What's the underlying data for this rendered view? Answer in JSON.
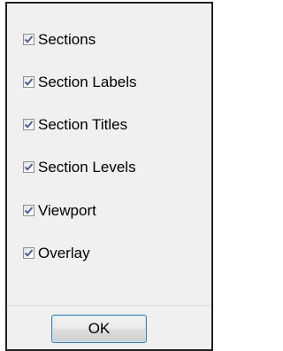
{
  "options": [
    {
      "label": "Sections",
      "checked": true
    },
    {
      "label": "Section Labels",
      "checked": true
    },
    {
      "label": "Section Titles",
      "checked": true
    },
    {
      "label": "Section Levels",
      "checked": true
    },
    {
      "label": "Viewport",
      "checked": true
    },
    {
      "label": "Overlay",
      "checked": true
    }
  ],
  "buttons": {
    "ok_label": "OK"
  },
  "colors": {
    "check_mark": "#4a5f97",
    "button_border": "#3c7fb1",
    "dialog_border": "#222222"
  },
  "icons": {
    "checkbox": "checkmark-icon"
  }
}
